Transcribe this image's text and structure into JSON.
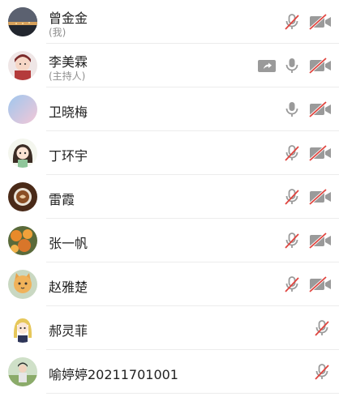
{
  "participants": [
    {
      "name": "曾金金",
      "subtitle": "(我)",
      "mic": "muted",
      "camera": "off",
      "sharing": false,
      "avatar": "night-city-avatar"
    },
    {
      "name": "李美霖",
      "subtitle": "(主持人)",
      "mic": "on",
      "camera": "off",
      "sharing": true,
      "avatar": "anime-girl-avatar"
    },
    {
      "name": "卫晓梅",
      "subtitle": "",
      "mic": "on",
      "camera": "off",
      "sharing": false,
      "avatar": "pastel-sky-avatar"
    },
    {
      "name": "丁环宇",
      "subtitle": "",
      "mic": "muted",
      "camera": "off",
      "sharing": false,
      "avatar": "cartoon-girl-avatar"
    },
    {
      "name": "雷霞",
      "subtitle": "",
      "mic": "muted",
      "camera": "off",
      "sharing": false,
      "avatar": "coffee-cup-avatar"
    },
    {
      "name": "张一帆",
      "subtitle": "",
      "mic": "muted",
      "camera": "off",
      "sharing": false,
      "avatar": "orange-flowers-avatar"
    },
    {
      "name": "赵雅楚",
      "subtitle": "",
      "mic": "muted",
      "camera": "off",
      "sharing": false,
      "avatar": "cat-avatar"
    },
    {
      "name": "郝灵菲",
      "subtitle": "",
      "mic": "muted",
      "camera": "hidden",
      "sharing": false,
      "avatar": "anime-blonde-avatar"
    },
    {
      "name": "喻婷婷20211701001",
      "subtitle": "",
      "mic": "muted",
      "camera": "hidden",
      "sharing": false,
      "avatar": "outdoor-photo-avatar"
    }
  ],
  "colors": {
    "icon_gray": "#9a9a9a",
    "muted_red": "#e0453f",
    "divider": "#ececec",
    "name_text": "#222222",
    "sub_text": "#8f8f8f"
  }
}
